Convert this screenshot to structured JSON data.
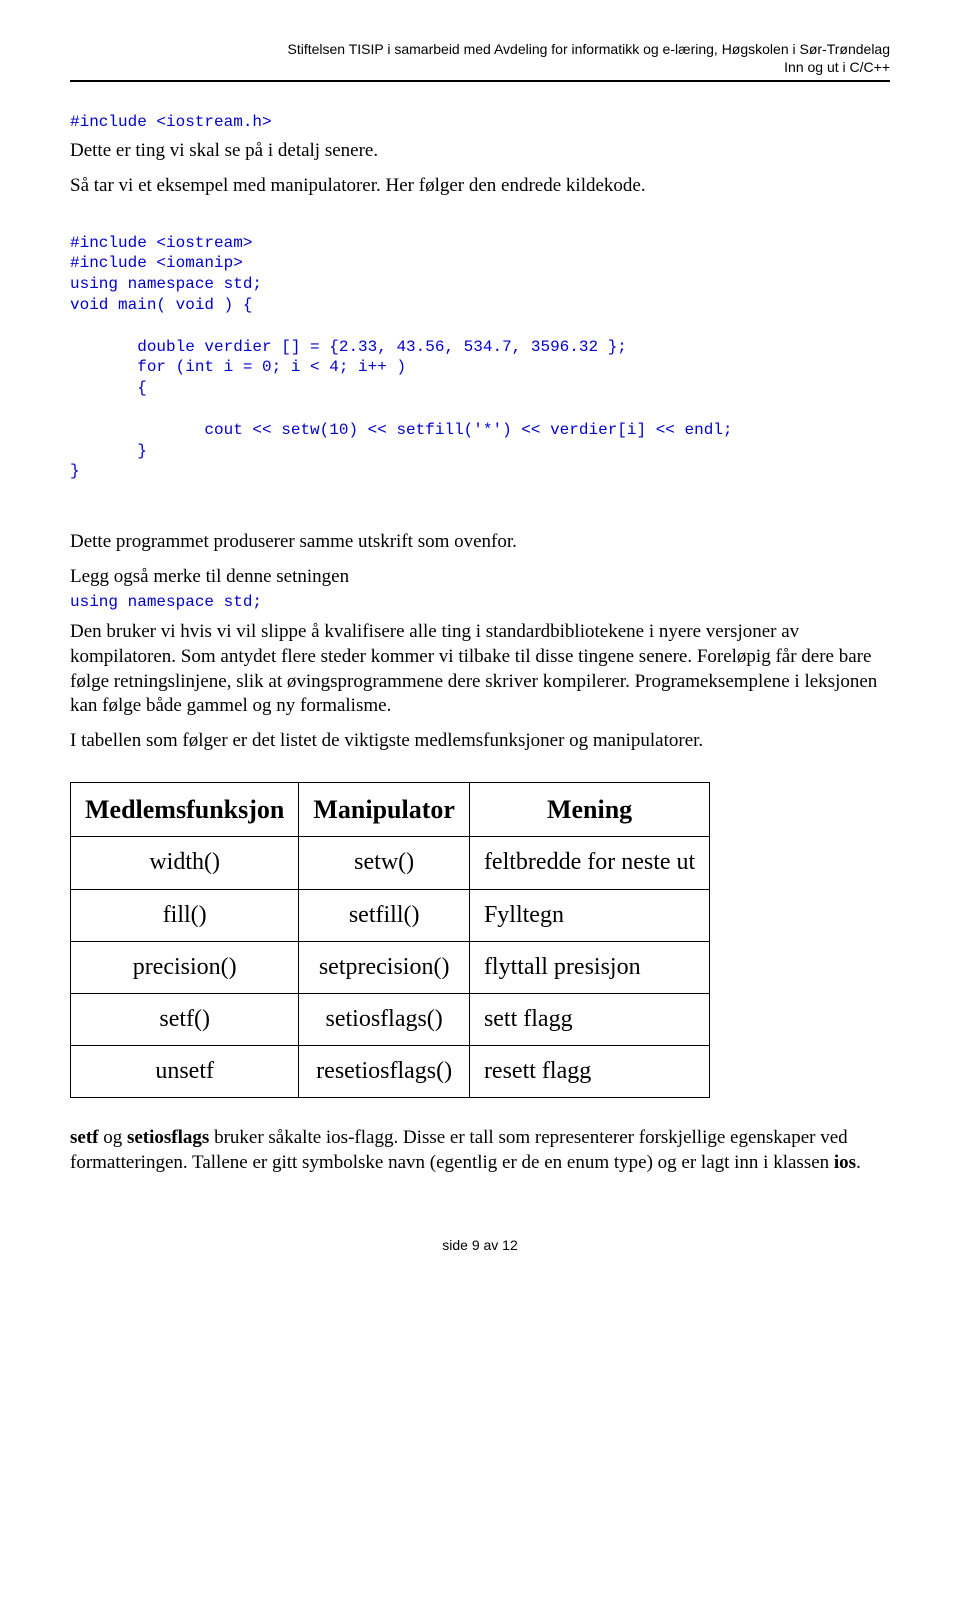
{
  "header": {
    "line1": "Stiftelsen TISIP i samarbeid med Avdeling for informatikk og e-læring, Høgskolen i Sør-Trøndelag",
    "line2": "Inn og ut i C/C++"
  },
  "c1": "#include <iostream.h>",
  "p1": "Dette er ting vi skal se på i detalj senere.",
  "p2": "Så tar vi et eksempel med manipulatorer. Her følger den endrede kildekode.",
  "code_block": "#include <iostream>\n#include <iomanip>\nusing namespace std;\nvoid main( void ) {\n\n       double verdier [] = {2.33, 43.56, 534.7, 3596.32 };\n       for (int i = 0; i < 4; i++ )\n       {\n\n              cout << setw(10) << setfill('*') << verdier[i] << endl;\n       }\n}",
  "p3": "Dette programmet produserer samme utskrift som ovenfor.",
  "p4a": "Legg også merke til denne setningen",
  "p4b": "using namespace std;",
  "p5": "Den bruker vi hvis vi vil slippe å kvalifisere alle ting i standardbibliotekene i nyere versjoner av kompilatoren. Som antydet flere steder kommer vi tilbake til disse tingene senere. Foreløpig får dere bare følge retningslinjene, slik at øvingsprogrammene dere skriver kompilerer. Programeksemplene i leksjonen kan følge både gammel og ny formalisme.",
  "p6": "I tabellen som følger er det listet de viktigste medlemsfunksjoner og manipulatorer.",
  "table": {
    "head": [
      "Medlemsfunksjon",
      "Manipulator",
      "Mening"
    ],
    "rows": [
      [
        "width()",
        "setw()",
        "feltbredde for neste ut"
      ],
      [
        "fill()",
        "setfill()",
        "Fylltegn"
      ],
      [
        "precision()",
        "setprecision()",
        "flyttall presisjon"
      ],
      [
        "setf()",
        "setiosflags()",
        "sett flagg"
      ],
      [
        "unsetf",
        "resetiosflags()",
        "resett flagg"
      ]
    ]
  },
  "p7a": "setf",
  "p7b": " og ",
  "p7c": "setiosflags",
  "p7d": " bruker såkalte ios-flagg. Disse er tall som representerer forskjellige egenskaper ved formatteringen. Tallene er gitt symbolske navn (egentlig er de en enum type) og er lagt inn i klassen  ",
  "p7e": "ios",
  "p7f": ".",
  "footer": "side 9 av 12"
}
